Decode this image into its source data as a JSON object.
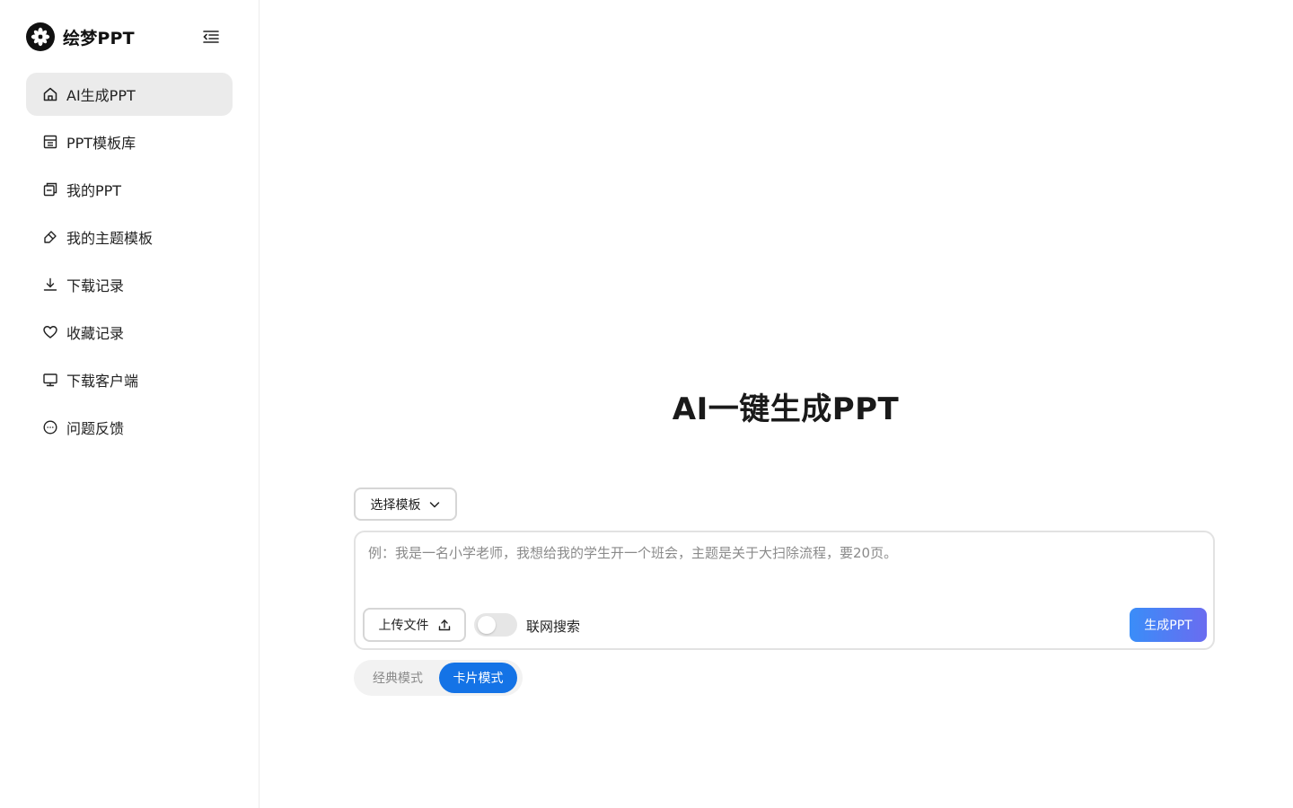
{
  "app": {
    "brand_name": "绘梦PPT",
    "brand_color": "#111111",
    "accent_color": "#1473e6"
  },
  "sidebar": {
    "items": [
      {
        "label": "AI生成PPT",
        "icon": "home-icon",
        "active": true
      },
      {
        "label": "PPT模板库",
        "icon": "template-library-icon",
        "active": false
      },
      {
        "label": "我的PPT",
        "icon": "my-ppt-icon",
        "active": false
      },
      {
        "label": "我的主题模板",
        "icon": "brush-icon",
        "active": false
      },
      {
        "label": "下载记录",
        "icon": "download-icon",
        "active": false
      },
      {
        "label": "收藏记录",
        "icon": "heart-icon",
        "active": false
      },
      {
        "label": "下载客户端",
        "icon": "monitor-icon",
        "active": false
      },
      {
        "label": "问题反馈",
        "icon": "chat-icon",
        "active": false
      }
    ]
  },
  "main": {
    "title": "AI一键生成PPT",
    "template_select_label": "选择模板",
    "prompt_placeholder": "例：我是一名小学老师，我想给我的学生开一个班会，主题是关于大扫除流程，要20页。",
    "upload_label": "上传文件",
    "web_search_label": "联网搜索",
    "web_search_enabled": false,
    "generate_label": "生成PPT",
    "modes": [
      {
        "label": "经典模式",
        "active": false
      },
      {
        "label": "卡片模式",
        "active": true
      }
    ]
  }
}
